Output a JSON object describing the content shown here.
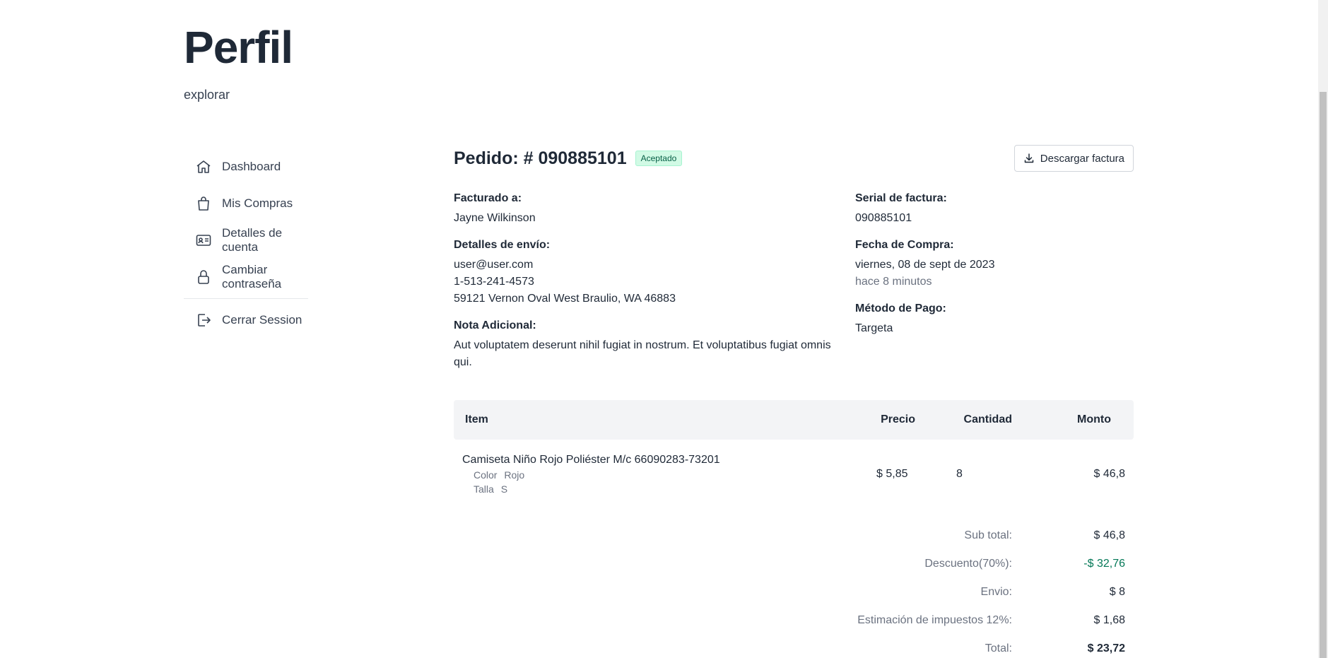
{
  "header": {
    "title": "Perfil",
    "subtitle": "explorar"
  },
  "sidebar": {
    "items": [
      {
        "label": "Dashboard",
        "icon": "home-icon"
      },
      {
        "label": "Mis Compras",
        "icon": "shopping-bag-icon"
      },
      {
        "label": "Detalles de cuenta",
        "icon": "id-card-icon"
      },
      {
        "label": "Cambiar contraseña",
        "icon": "lock-icon"
      }
    ],
    "logout": {
      "label": "Cerrar Session",
      "icon": "logout-icon"
    }
  },
  "order": {
    "title": "Pedido: # 090885101",
    "status": "Aceptado",
    "download_label": "Descargar factura",
    "billed_to_label": "Facturado a:",
    "billed_to": "Jayne Wilkinson",
    "shipping_label": "Detalles de envío:",
    "shipping_email": "user@user.com",
    "shipping_phone": "1-513-241-4573",
    "shipping_address": "59121 Vernon Oval West Braulio, WA 46883",
    "note_label": "Nota Adicional:",
    "note": "Aut voluptatem deserunt nihil fugiat in nostrum. Et voluptatibus fugiat omnis qui.",
    "serial_label": "Serial de factura:",
    "serial": "090885101",
    "date_label": "Fecha de Compra:",
    "date": "viernes, 08 de sept de 2023",
    "date_relative": "hace 8 minutos",
    "payment_label": "Método de Pago:",
    "payment": "Targeta"
  },
  "table": {
    "headers": {
      "item": "Item",
      "price": "Precio",
      "quantity": "Cantidad",
      "amount": "Monto"
    },
    "rows": [
      {
        "name": "Camiseta Niño Rojo Poliéster M/c 66090283-73201",
        "option1_key": "Color",
        "option1_value": "Rojo",
        "option2_key": "Talla",
        "option2_value": "S",
        "price": "$ 5,85",
        "quantity": "8",
        "amount": "$ 46,8"
      }
    ]
  },
  "totals": {
    "subtotal_label": "Sub total:",
    "subtotal": "$ 46,8",
    "discount_label": "Descuento(70%):",
    "discount": "-$ 32,76",
    "shipping_label": "Envio:",
    "shipping": "$ 8",
    "tax_label": "Estimación de impuestos 12%:",
    "tax": "$ 1,68",
    "total_label": "Total:",
    "total": "$ 23,72"
  },
  "colors": {
    "accent_green": "#047857",
    "badge_bg": "#d1fae5",
    "table_header_bg": "#f3f4f6"
  }
}
